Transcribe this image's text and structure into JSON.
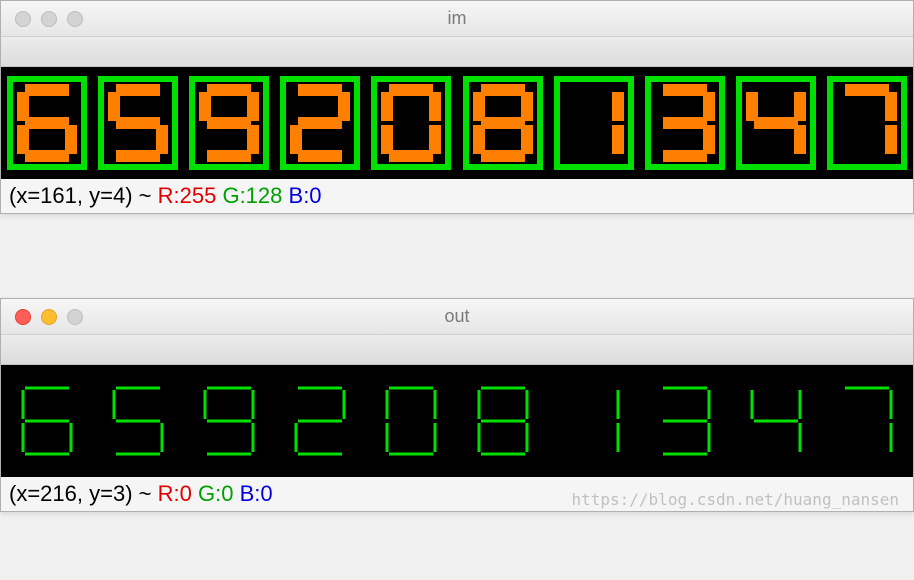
{
  "windows": [
    {
      "id": "im",
      "title": "im",
      "active": false,
      "digits": [
        "6",
        "5",
        "9",
        "2",
        "0",
        "8",
        "1",
        "3",
        "4",
        "7"
      ],
      "style": "boxed",
      "status": {
        "coord": "(x=161, y=4) ~ ",
        "r": "R:255",
        "g": "G:128",
        "b": "B:0"
      }
    },
    {
      "id": "out",
      "title": "out",
      "active": true,
      "digits": [
        "6",
        "5",
        "9",
        "2",
        "0",
        "8",
        "1",
        "3",
        "4",
        "7"
      ],
      "style": "thin",
      "status": {
        "coord": "(x=216, y=3) ~ ",
        "r": "R:0",
        "g": "G:0",
        "b": "B:0"
      }
    }
  ],
  "watermark": "https://blog.csdn.net/huang_nansen"
}
